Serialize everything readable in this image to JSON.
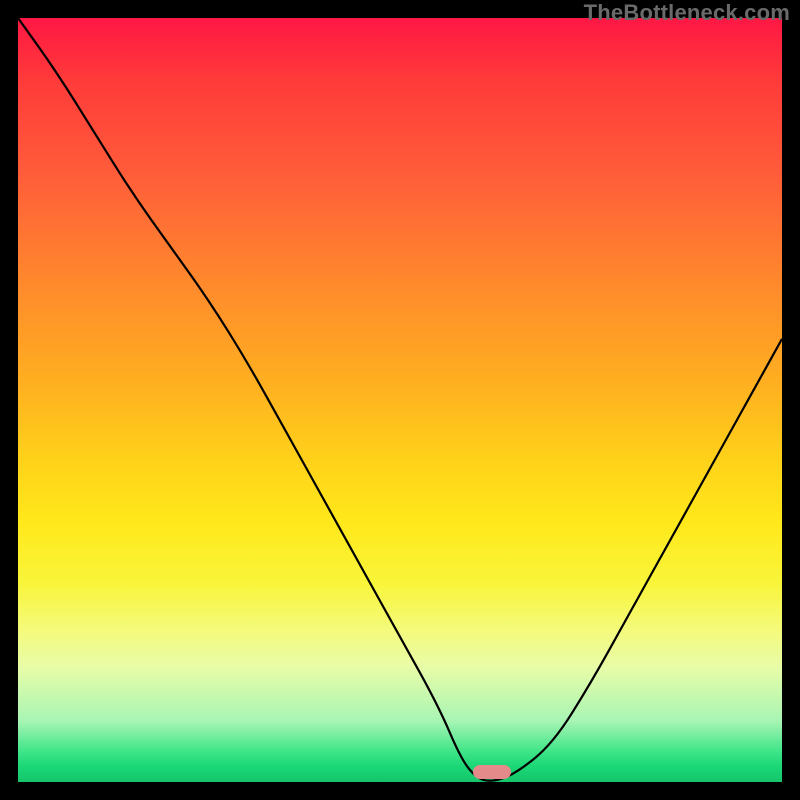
{
  "watermark": "TheBottleneck.com",
  "colors": {
    "frame_bg": "#000000",
    "curve_stroke": "#000000",
    "marker_fill": "#e58a8a",
    "gradient_top": "#ff1744",
    "gradient_mid": "#ffd21a",
    "gradient_bottom": "#15c56a"
  },
  "chart_data": {
    "type": "line",
    "title": "",
    "xlabel": "",
    "ylabel": "",
    "xlim": [
      0,
      100
    ],
    "ylim": [
      0,
      100
    ],
    "grid": false,
    "x": [
      0,
      5,
      10,
      15,
      20,
      25,
      30,
      35,
      40,
      45,
      50,
      55,
      58,
      60,
      62,
      65,
      70,
      75,
      80,
      85,
      90,
      95,
      100
    ],
    "values": [
      100,
      93,
      85,
      77,
      70,
      63,
      55,
      46,
      37,
      28,
      19,
      10,
      3,
      0.5,
      0,
      1,
      5,
      13,
      22,
      31,
      40,
      49,
      58
    ],
    "optimum_x": 62,
    "note": "V-shaped bottleneck curve; minimum (≈0) near x≈62% indicates balanced pairing. Colored background encodes bottleneck severity: green≈0, red≈100."
  }
}
